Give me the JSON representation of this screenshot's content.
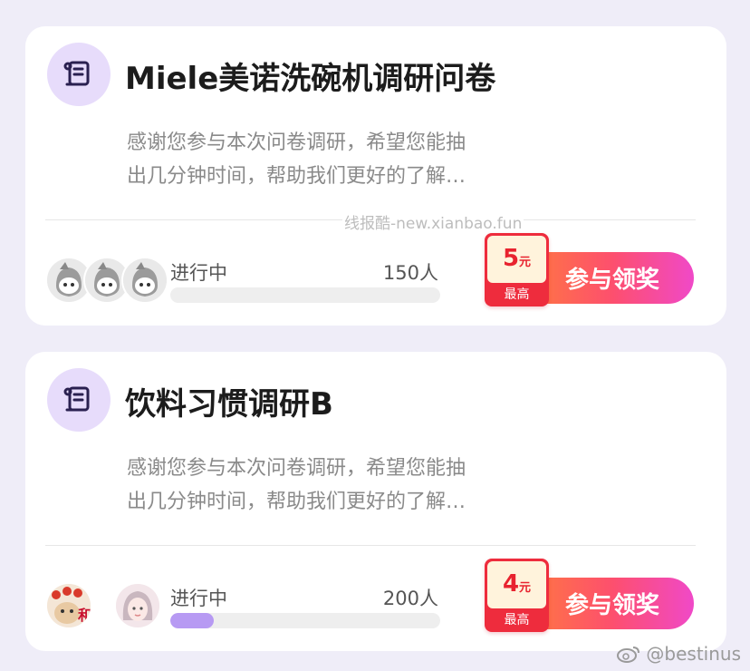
{
  "surveys": [
    {
      "title": "Miele美诺洗碗机调研问卷",
      "desc_line1": "感谢您参与本次问卷调研，希望您能抽",
      "desc_line2": "出几分钟时间，帮助我们更好的了解…",
      "status": "进行中",
      "participants": "150人",
      "progress": 0,
      "reward_amount": "5",
      "reward_unit": "元",
      "reward_label": "最高",
      "button": "参与领奖"
    },
    {
      "title": "饮料习惯调研B",
      "desc_line1": "感谢您参与本次问卷调研，希望您能抽",
      "desc_line2": "出几分钟时间，帮助我们更好的了解…",
      "status": "进行中",
      "participants": "200人",
      "progress": 0.16,
      "reward_amount": "4",
      "reward_unit": "元",
      "reward_label": "最高",
      "button": "参与领奖"
    }
  ],
  "watermark": "线报酷-new.xianbao.fun",
  "weibo_handle": "@bestinus",
  "colors": {
    "background": "#efedf8",
    "icon_bg": "#e7dcfb",
    "icon": "#2a2050",
    "progress": "#b79af3",
    "reward_red": "#ee2c3d",
    "button_start": "#ff7e3a",
    "button_end": "#f049c8"
  }
}
